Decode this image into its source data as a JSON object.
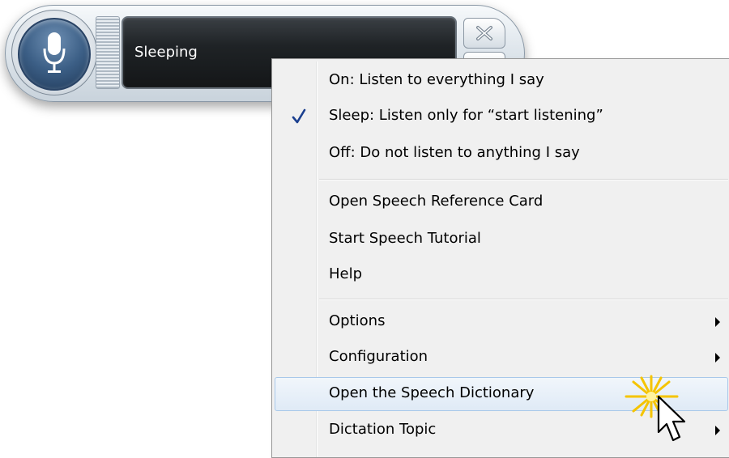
{
  "speech_bar": {
    "status": "Sleeping",
    "microphone_icon": "microphone-icon",
    "close_icon": "close-icon"
  },
  "context_menu": {
    "groups": [
      [
        {
          "label": "On: Listen to everything I say",
          "checked": false,
          "submenu": false
        },
        {
          "label": "Sleep: Listen only for “start listening”",
          "checked": true,
          "submenu": false
        },
        {
          "label": "Off: Do not listen to anything I say",
          "checked": false,
          "submenu": false
        }
      ],
      [
        {
          "label": "Open Speech Reference Card",
          "checked": false,
          "submenu": false
        },
        {
          "label": "Start Speech Tutorial",
          "checked": false,
          "submenu": false
        },
        {
          "label": "Help",
          "checked": false,
          "submenu": false
        }
      ],
      [
        {
          "label": "Options",
          "checked": false,
          "submenu": true
        },
        {
          "label": "Configuration",
          "checked": false,
          "submenu": true
        },
        {
          "label": "Open the Speech Dictionary",
          "checked": false,
          "submenu": false,
          "highlighted": true
        },
        {
          "label": "Dictation Topic",
          "checked": false,
          "submenu": true
        }
      ]
    ]
  },
  "colors": {
    "menu_background": "#f0f0f0",
    "highlight_border": "#a8c8ea",
    "check_color": "#1a3f8f",
    "burst_color": "#f5c400"
  }
}
